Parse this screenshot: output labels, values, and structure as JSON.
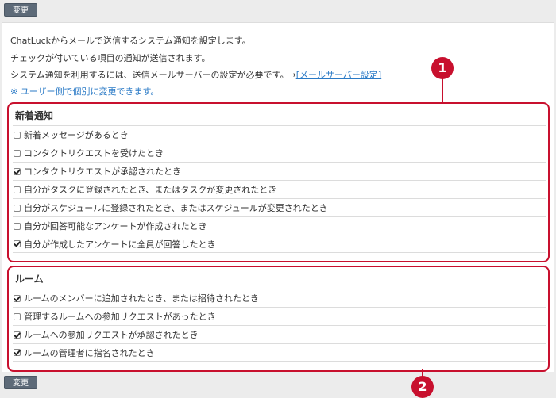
{
  "buttons": {
    "submit_label": "変更"
  },
  "intro": {
    "line1": "ChatLuckからメールで送信するシステム通知を設定します。",
    "line2": "チェックが付いている項目の通知が送信されます。",
    "line3_prefix": "システム通知を利用するには、送信メールサーバーの設定が必要です。→",
    "line3_link": "[メールサーバー設定]",
    "line4": "※ ユーザー側で個別に変更できます。"
  },
  "sections": {
    "new": {
      "title": "新着通知",
      "items": [
        {
          "label": "新着メッセージがあるとき",
          "checked": false
        },
        {
          "label": "コンタクトリクエストを受けたとき",
          "checked": false
        },
        {
          "label": "コンタクトリクエストが承認されたとき",
          "checked": true
        },
        {
          "label": "自分がタスクに登録されたとき、またはタスクが変更されたとき",
          "checked": false
        },
        {
          "label": "自分がスケジュールに登録されたとき、またはスケジュールが変更されたとき",
          "checked": false
        },
        {
          "label": "自分が回答可能なアンケートが作成されたとき",
          "checked": false
        },
        {
          "label": "自分が作成したアンケートに全員が回答したとき",
          "checked": true
        }
      ]
    },
    "room": {
      "title": "ルーム",
      "items": [
        {
          "label": "ルームのメンバーに追加されたとき、または招待されたとき",
          "checked": true
        },
        {
          "label": "管理するルームへの参加リクエストがあったとき",
          "checked": false
        },
        {
          "label": "ルームへの参加リクエストが承認されたとき",
          "checked": true
        },
        {
          "label": "ルームの管理者に指名されたとき",
          "checked": true
        }
      ]
    }
  },
  "callouts": {
    "one": "1",
    "two": "2"
  },
  "colors": {
    "accent_red": "#c8102e",
    "link_blue": "#2a7ac6",
    "button_gray": "#5d6a78"
  }
}
